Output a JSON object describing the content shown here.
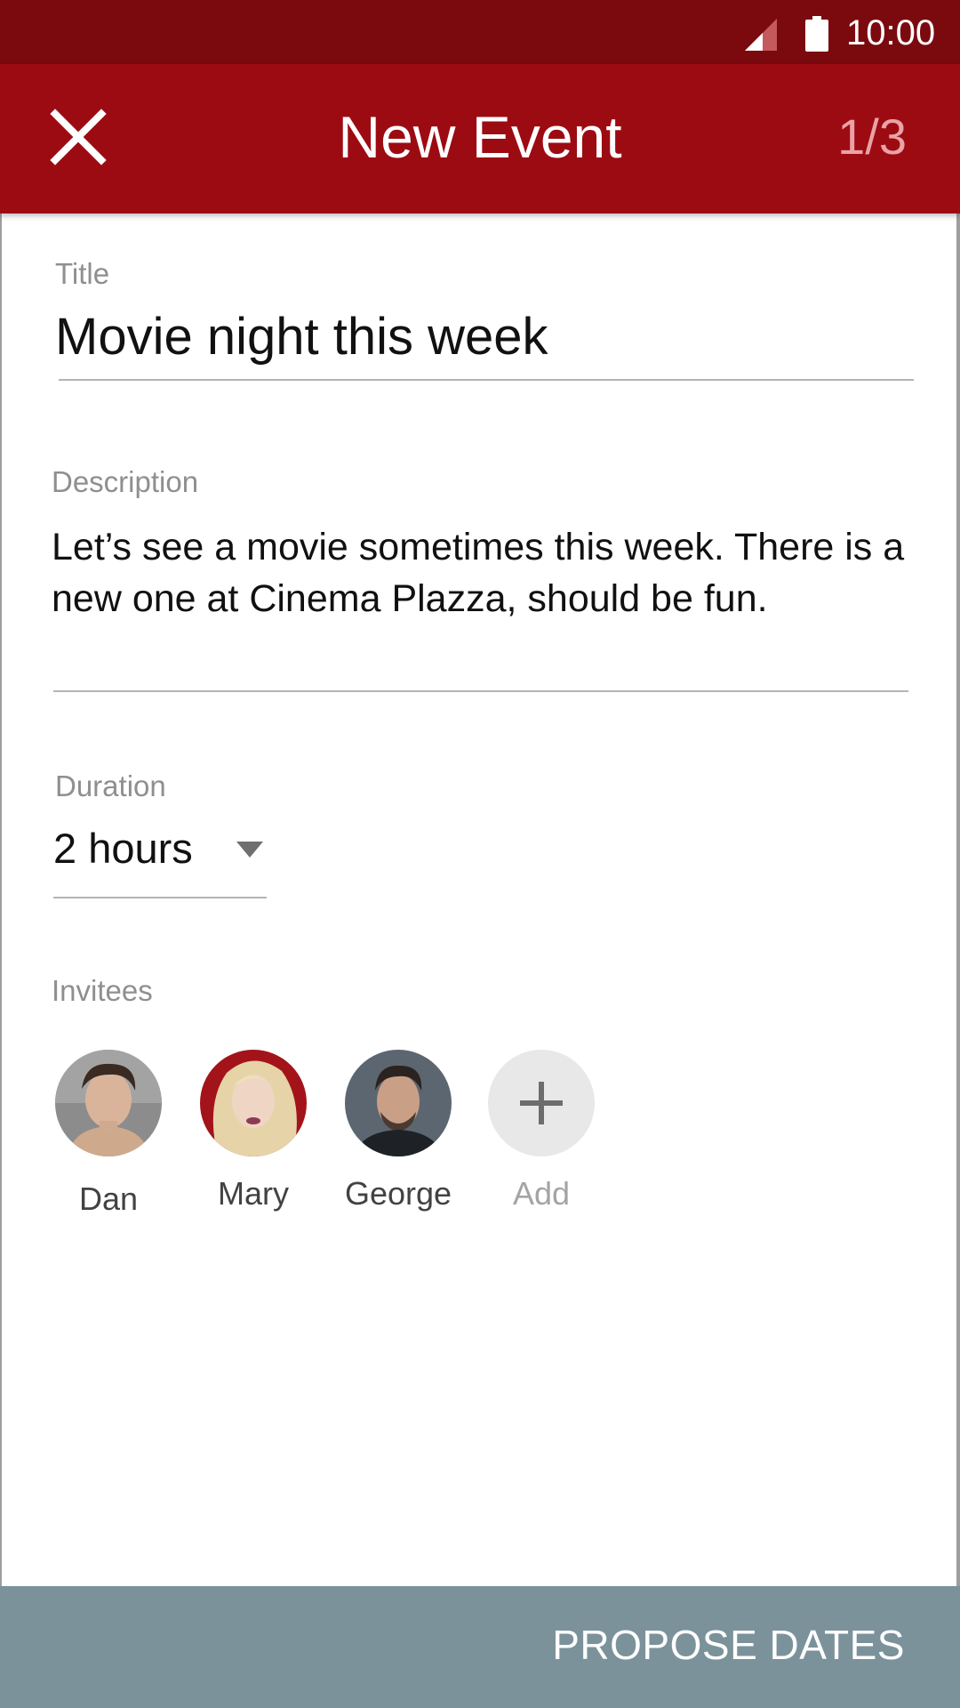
{
  "status_bar": {
    "time": "10:00",
    "icons": [
      "signal-icon",
      "battery-icon"
    ]
  },
  "app_bar": {
    "close_icon": "close-icon",
    "title": "New Event",
    "step": "1/3"
  },
  "form": {
    "title": {
      "label": "Title",
      "value": "Movie night this week"
    },
    "description": {
      "label": "Description",
      "value": "Let’s see a movie sometimes this week. There is a new one at Cinema Plazza, should be fun."
    },
    "duration": {
      "label": "Duration",
      "value": "2 hours"
    },
    "invitees": {
      "label": "Invitees",
      "people": [
        {
          "name": "Dan"
        },
        {
          "name": "Mary"
        },
        {
          "name": "George"
        }
      ],
      "add_label": "Add"
    }
  },
  "footer": {
    "action_label": "PROPOSE DATES"
  },
  "colors": {
    "status_bar": "#7b0a0f",
    "app_bar": "#9d0b12",
    "step_counter": "#e9a3a6",
    "bottom_bar": "#7b929b",
    "label_gray": "#8f8f8f"
  }
}
